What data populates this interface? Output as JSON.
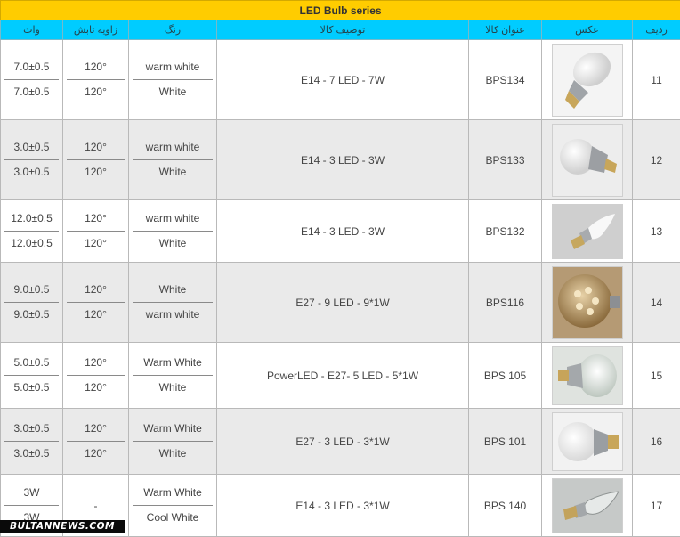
{
  "title": "LED Bulb series",
  "headers": {
    "watt": "وات",
    "angle": "زاویه تابش",
    "color": "رنگ",
    "description": "توصیف کالا",
    "code": "عنوان کالا",
    "image": "عکس",
    "row": "ردیف"
  },
  "rows": [
    {
      "id": "11",
      "code": "BPS134",
      "description": "E14 - 7 LED - 7W",
      "color_1": "warm white",
      "color_2": "White",
      "angle_1": "120°",
      "angle_2": "120°",
      "watt_1": "7.0±0.5",
      "watt_2": "7.0±0.5",
      "image_icon": "led-bulb-e27-photo"
    },
    {
      "id": "12",
      "code": "BPS133",
      "description": "E14 - 3 LED - 3W",
      "color_1": "warm white",
      "color_2": "White",
      "angle_1": "120°",
      "angle_2": "120°",
      "watt_1": "3.0±0.5",
      "watt_2": "3.0±0.5",
      "image_icon": "led-bulb-e14-photo"
    },
    {
      "id": "13",
      "code": "BPS132",
      "description": "E14 - 3 LED - 3W",
      "color_1": "warm white",
      "color_2": "White",
      "angle_1": "120°",
      "angle_2": "120°",
      "watt_1": "12.0±0.5",
      "watt_2": "12.0±0.5",
      "image_icon": "led-candle-bulb-photo"
    },
    {
      "id": "14",
      "code": "BPS116",
      "description": "E27 - 9 LED - 9*1W",
      "color_1": "White",
      "color_2": "warm white",
      "angle_1": "120°",
      "angle_2": "120°",
      "watt_1": "9.0±0.5",
      "watt_2": "9.0±0.5",
      "image_icon": "led-globe-bulb-photo"
    },
    {
      "id": "15",
      "code": "BPS 105",
      "description": "PowerLED - E27- 5 LED - 5*1W",
      "color_1": "Warm White",
      "color_2": "White",
      "angle_1": "120°",
      "angle_2": "120°",
      "watt_1": "5.0±0.5",
      "watt_2": "5.0±0.5",
      "image_icon": "power-led-bulb-photo"
    },
    {
      "id": "16",
      "code": "BPS 101",
      "description": "E27 - 3 LED - 3*1W",
      "color_1": "Warm White",
      "color_2": "White",
      "angle_1": "120°",
      "angle_2": "120°",
      "watt_1": "3.0±0.5",
      "watt_2": "3.0±0.5",
      "image_icon": "led-bulb-e27-photo"
    },
    {
      "id": "17",
      "code": "BPS 140",
      "description": "E14 - 3 LED - 3*1W",
      "color_1": "Warm White",
      "color_2": "Cool White",
      "angle_1": "-",
      "angle_2": "",
      "watt_1": "3W",
      "watt_2": "3W",
      "image_icon": "led-candle-clear-photo"
    }
  ],
  "watermark": "BULTANNEWS.COM",
  "colors": {
    "title_bg": "#ffcc00",
    "header_bg": "#00ccff",
    "even_row_bg": "#eaeaea"
  }
}
